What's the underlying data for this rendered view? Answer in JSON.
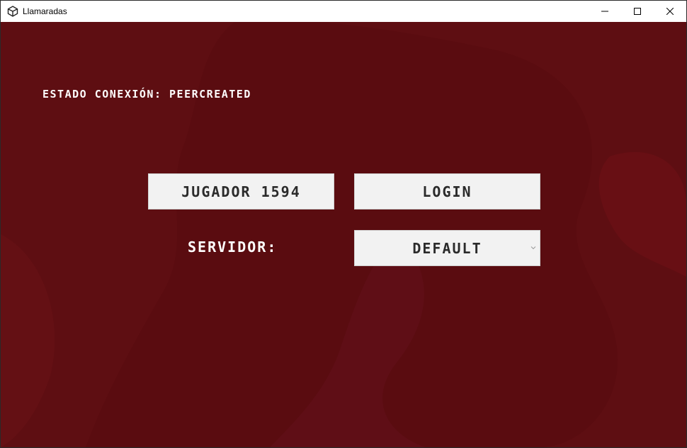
{
  "window": {
    "title": "Llamaradas",
    "icon": "unity-icon",
    "controls": [
      "minimize-icon",
      "maximize-icon",
      "close-icon"
    ]
  },
  "status": {
    "text": "ESTADO CONEXIÓN: PEERCREATED"
  },
  "player": {
    "label": "JUGADOR 1594"
  },
  "login": {
    "label": "LOGIN"
  },
  "server": {
    "label": "SERVIDOR:",
    "selected": "DEFAULT"
  },
  "colors": {
    "background": "#5e0e12",
    "button_bg": "#f2f2f2",
    "button_text": "#2b2b2b",
    "label_text": "#ffffff"
  }
}
